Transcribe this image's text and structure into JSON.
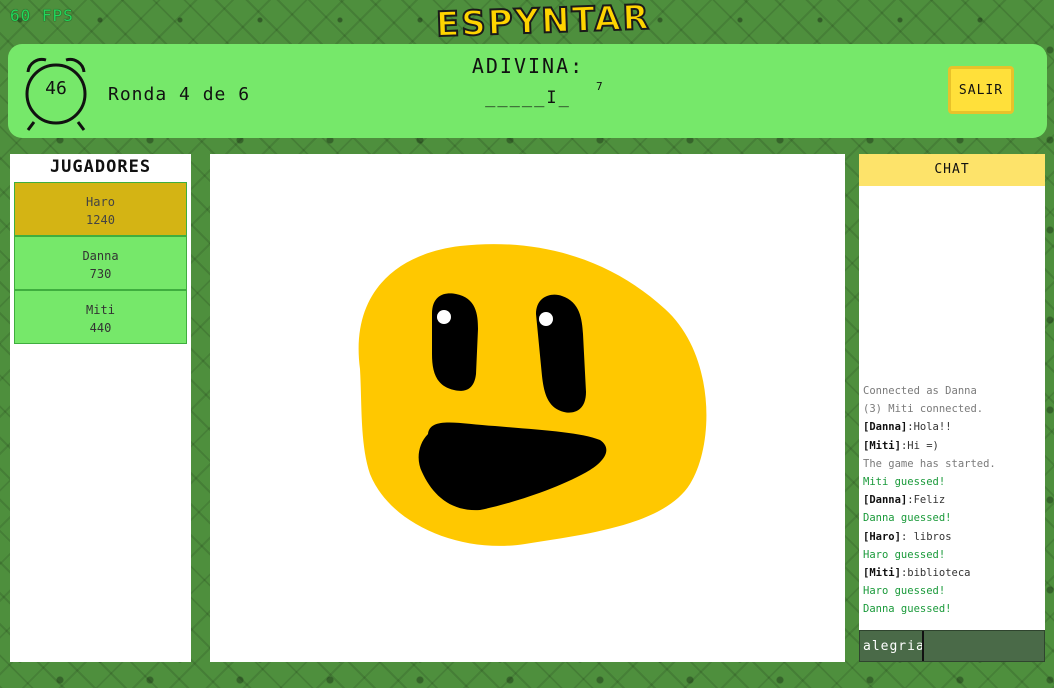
{
  "fps": "60 FPS",
  "logo": "ESPYNTAR",
  "header": {
    "timer": "46",
    "round_text": "Ronda 4 de 6",
    "guess_title": "ADIVINA:",
    "word_hint": "_____I_",
    "word_length": "7",
    "exit_label": "SALIR"
  },
  "players": {
    "title": "JUGADORES",
    "list": [
      {
        "name": "Haro",
        "score": "1240"
      },
      {
        "name": "Danna",
        "score": "730"
      },
      {
        "name": "Miti",
        "score": "440"
      }
    ]
  },
  "chat": {
    "title": "CHAT",
    "messages": [
      {
        "type": "sys",
        "text": "Connected as Danna"
      },
      {
        "type": "sys",
        "text": "(3) Miti connected."
      },
      {
        "type": "usr",
        "user": "[Danna]",
        "text": ":Hola!!"
      },
      {
        "type": "usr",
        "user": "[Miti]",
        "text": ":Hi =)"
      },
      {
        "type": "sys",
        "text": "The game has started."
      },
      {
        "type": "ok",
        "text": "Miti guessed!"
      },
      {
        "type": "usr",
        "user": "[Danna]",
        "text": ":Feliz"
      },
      {
        "type": "ok",
        "text": "Danna guessed!"
      },
      {
        "type": "usr",
        "user": "[Haro]",
        "text": ": libros"
      },
      {
        "type": "ok",
        "text": "Haro guessed!"
      },
      {
        "type": "usr",
        "user": "[Miti]",
        "text": ":biblioteca"
      },
      {
        "type": "ok",
        "text": "Haro guessed!"
      },
      {
        "type": "ok",
        "text": "Danna guessed!"
      }
    ],
    "input_value": "alegria"
  },
  "colors": {
    "panel_green": "#76e86a",
    "accent_yellow": "#ffe03a",
    "current_player": "#d4b414",
    "drawing_yellow": "#ffc800"
  }
}
